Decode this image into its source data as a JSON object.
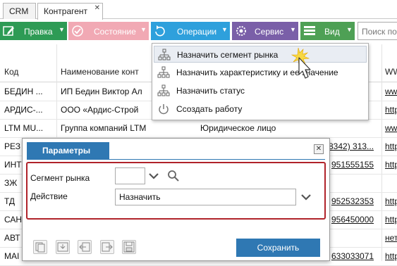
{
  "tabs": [
    {
      "label": "CRM"
    },
    {
      "label": "Контрагент",
      "active": true
    }
  ],
  "tab_close": "✕",
  "toolbar": {
    "edit": "Правка",
    "state": "Состояние",
    "operations": "Операции",
    "service": "Сервис",
    "view": "Вид",
    "search_placeholder": "Поиск по",
    "colors": {
      "edit": "#2e9b55",
      "state": "#f1a9b4",
      "operations": "#2ea0dc",
      "service": "#7a5fa8",
      "view": "#4ea055"
    }
  },
  "grid": {
    "headers": [
      "Код",
      "Наименование конт",
      "WW"
    ],
    "rows": [
      {
        "code": "БЕДИН ...",
        "name": "ИП Бедин Виктор Ал",
        "extra": "",
        "link": "www"
      },
      {
        "code": "АРДИС-...",
        "name": "ООО «Ардис-Строй",
        "extra": "",
        "link": "http"
      },
      {
        "code": "LTM MU...",
        "name": "Группа компаний LTM",
        "extra": "Юридическое лицо",
        "link": "www"
      },
      {
        "code": "РЕЗ",
        "name": "",
        "extra": "8342) 313...",
        "link": "http"
      },
      {
        "code": "ИНТ",
        "name": "",
        "extra": "951555155",
        "link": "http"
      },
      {
        "code": "ЗЖ",
        "name": "",
        "extra": "",
        "link": ""
      },
      {
        "code": "ТД",
        "name": "",
        "extra": "952532353",
        "link": "http"
      },
      {
        "code": "САН",
        "name": "",
        "extra": "956450000",
        "link": "http"
      },
      {
        "code": "АВТ",
        "name": "",
        "extra": "",
        "link": "нет"
      },
      {
        "code": "МАІ",
        "name": "",
        "extra": "633033071",
        "link": "http"
      }
    ]
  },
  "menu": {
    "items": [
      {
        "label": "Назначить сегмент рынка",
        "icon": "hierarchy-icon"
      },
      {
        "label": "Назначить характеристику и ее значение",
        "icon": "hierarchy-icon"
      },
      {
        "label": "Назначить статус",
        "icon": "hierarchy-icon"
      },
      {
        "label": "Ссоздать работу",
        "icon": "power-icon"
      }
    ]
  },
  "dialog": {
    "title": "Параметры",
    "close": "✕",
    "segment_label": "Сегмент рынка",
    "segment_value": "",
    "action_label": "Действие",
    "action_value": "Назначить",
    "save_label": "Сохранить",
    "highlight_color": "#b0232a"
  }
}
